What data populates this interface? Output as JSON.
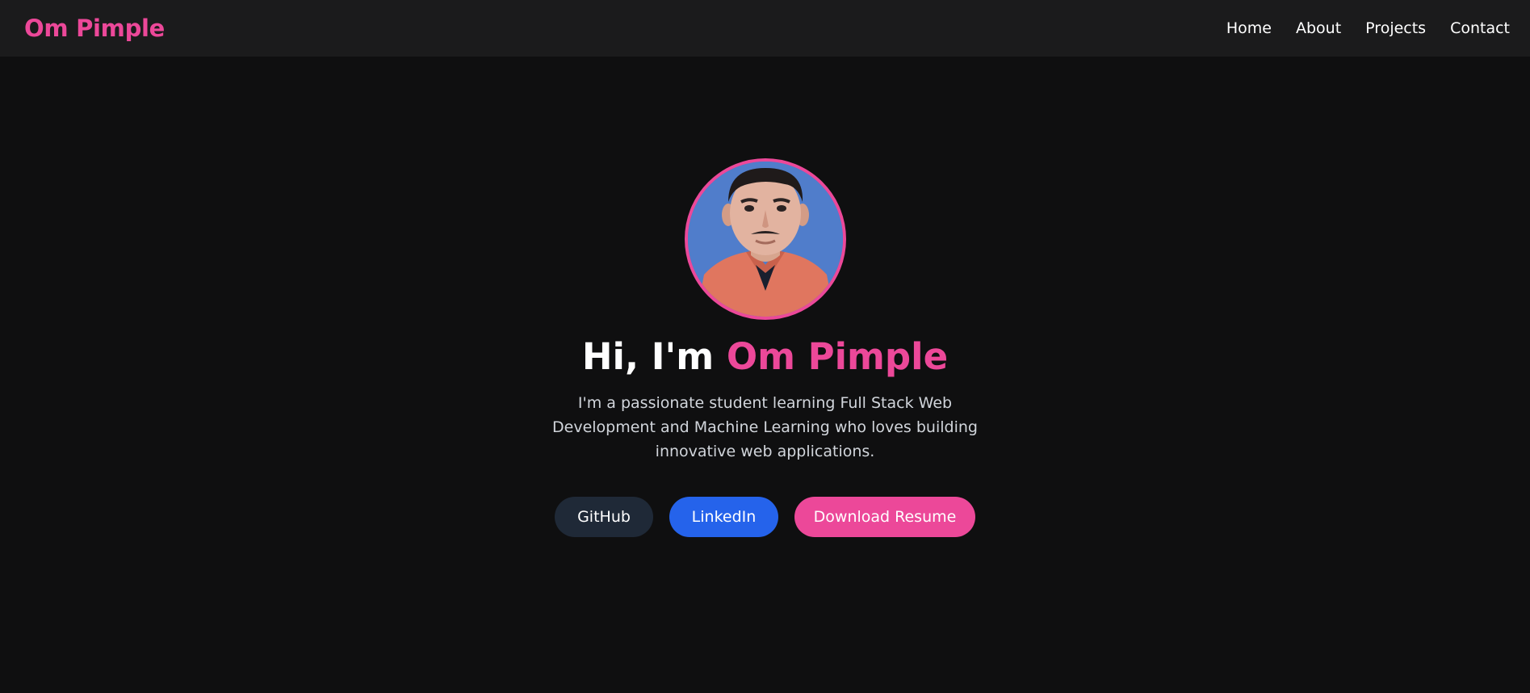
{
  "nav": {
    "brand": "Om Pimple",
    "links": [
      "Home",
      "About",
      "Projects",
      "Contact"
    ]
  },
  "hero": {
    "avatar_alt": "Profile photo of Om Pimple",
    "greeting": "Hi, I'm ",
    "name": "Om Pimple",
    "intro": "I'm a passionate student learning Full Stack Web Development and Machine Learning who loves building innovative web applications.",
    "buttons": {
      "github": "GitHub",
      "linkedin": "LinkedIn",
      "resume": "Download Resume"
    }
  },
  "colors": {
    "accent": "#ec4899",
    "background": "#0f0f10",
    "navbar": "#1b1b1c",
    "github_button": "#1f2937",
    "linkedin_button": "#2563eb"
  }
}
